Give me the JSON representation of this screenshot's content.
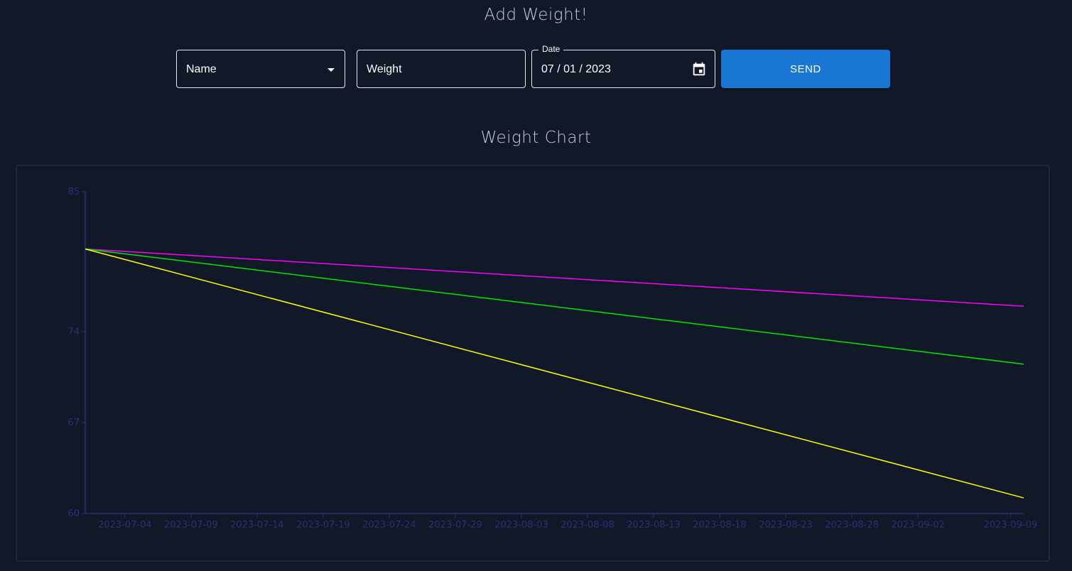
{
  "form": {
    "title": "Add Weight!",
    "name_select": {
      "value": "Name"
    },
    "weight_input": {
      "placeholder": "Weight"
    },
    "date_input": {
      "label": "Date",
      "value": "07 / 01 / 2023"
    },
    "send_label": "SEND"
  },
  "chart_section": {
    "title": "Weight Chart"
  },
  "colors": {
    "background": "#111827",
    "accent": "#1976d2",
    "axis": "#2b2f78"
  },
  "chart_data": {
    "type": "line",
    "y_ticks": [
      60,
      67,
      74,
      85
    ],
    "y_tick_labels": [
      "60",
      "67",
      "74",
      "85"
    ],
    "ylim": [
      60,
      85
    ],
    "x_ticks": [
      "2023-07-04",
      "2023-07-09",
      "2023-07-14",
      "2023-07-19",
      "2023-07-24",
      "2023-07-29",
      "2023-08-03",
      "2023-08-08",
      "2023-08-13",
      "2023-08-18",
      "2023-08-23",
      "2023-08-28",
      "2023-09-02",
      "2023-09-09"
    ],
    "xlim": [
      "2023-07-01",
      "2023-09-10"
    ],
    "grid": false,
    "series": [
      {
        "color": "#ff00ff",
        "points": [
          [
            "2023-07-01",
            80.5
          ],
          [
            "2023-09-10",
            76
          ]
        ]
      },
      {
        "color": "#00e600",
        "points": [
          [
            "2023-07-01",
            80.5
          ],
          [
            "2023-09-10",
            71.5
          ]
        ]
      },
      {
        "color": "#ffff00",
        "points": [
          [
            "2023-07-01",
            80.5
          ],
          [
            "2023-09-10",
            61.2
          ]
        ]
      }
    ]
  }
}
